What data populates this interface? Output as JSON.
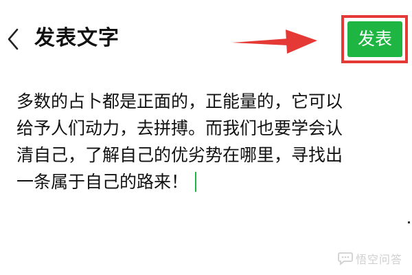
{
  "header": {
    "back_icon": "chevron-left-icon",
    "title": "发表文字",
    "publish_label": "发表"
  },
  "annotation": {
    "arrow_color": "#e53935",
    "highlight_color": "#e53935",
    "arrow_icon": "arrow-right-icon"
  },
  "editor": {
    "lines": [
      "多数的占卜都是正面的，正能量的，它可以",
      "给予人们动力，去拼搏。而我们也要学会认",
      "清自己，了解自己的优劣势在哪里，寻找出",
      "一条属于自己的路来！"
    ],
    "cursor_color": "#1fb542"
  },
  "watermark": {
    "text": "悟空问答",
    "icon": "chat-bubble-icon"
  },
  "colors": {
    "accent": "#1fb542",
    "text": "#111111",
    "background": "#ffffff"
  }
}
